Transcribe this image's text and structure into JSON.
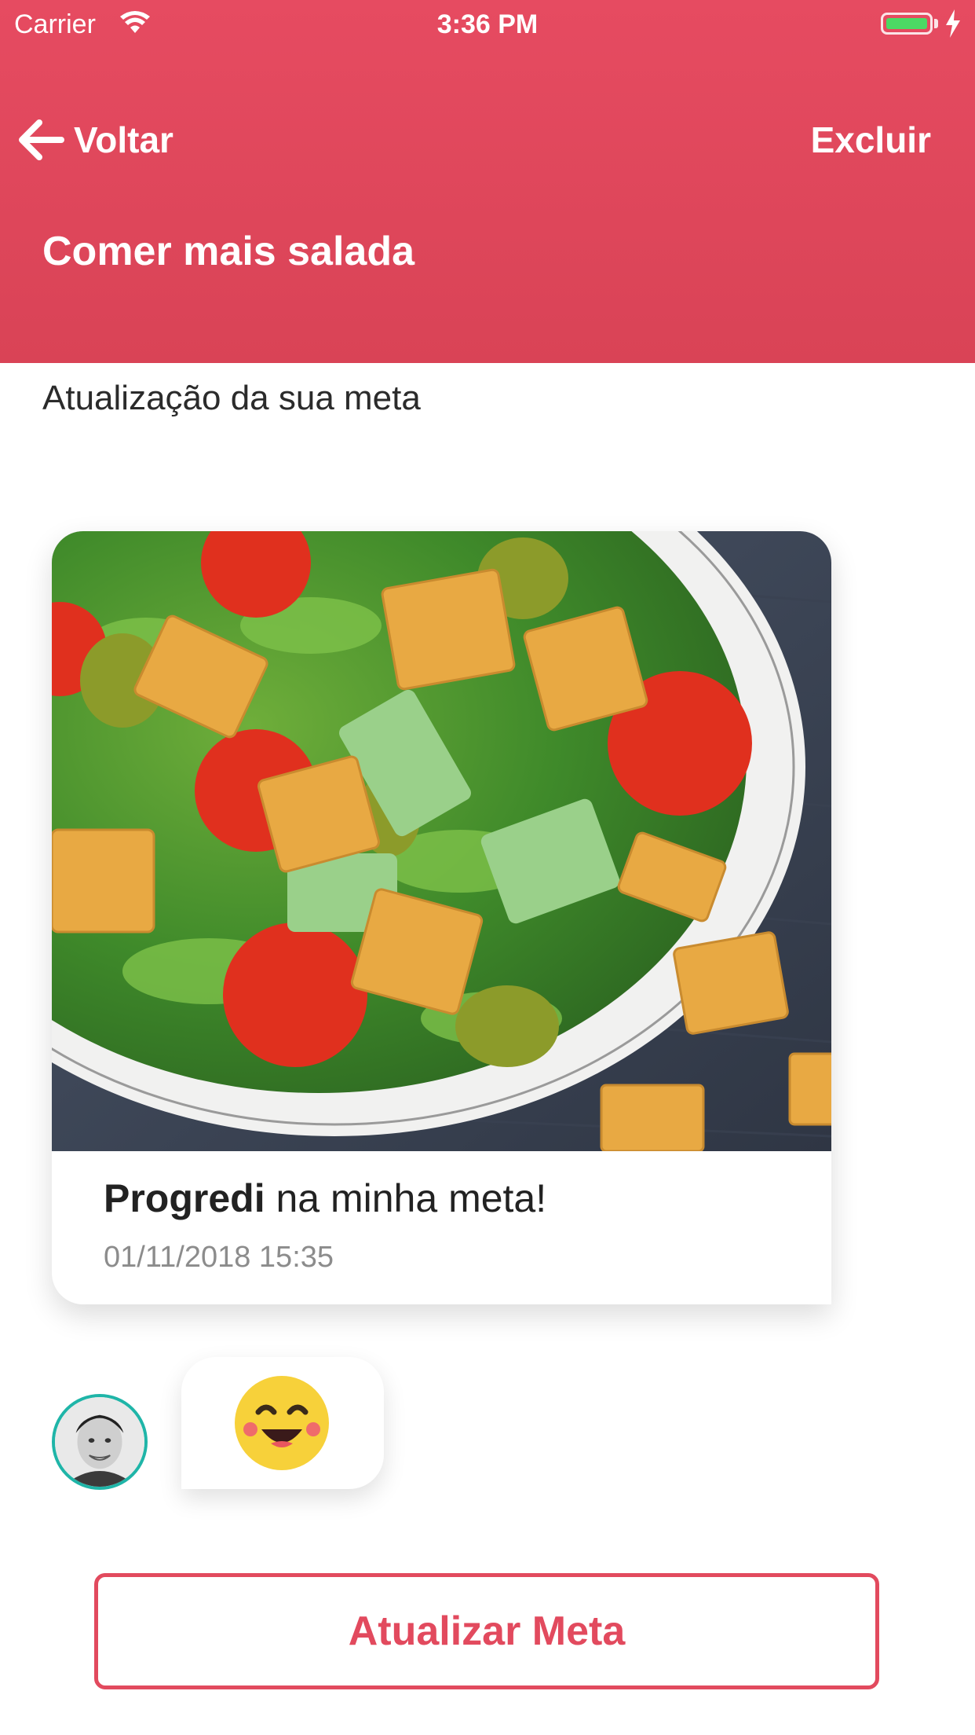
{
  "status_bar": {
    "carrier": "Carrier",
    "time": "3:36 PM",
    "wifi_icon": "wifi-icon",
    "battery_icon": "battery-icon",
    "charging_icon": "bolt-icon"
  },
  "header": {
    "back_label": "Voltar",
    "back_icon": "arrow-left-icon",
    "delete_label": "Excluir",
    "title": "Comer mais salada"
  },
  "main": {
    "subtitle": "Atualização da sua meta"
  },
  "update_card": {
    "image": "salad-photo",
    "text_bold": "Progredi",
    "text_rest": " na minha meta!",
    "date": "01/11/2018 15:35"
  },
  "reaction": {
    "avatar": "user-avatar",
    "emoji": "smiling-face-emoji"
  },
  "actions": {
    "update_label": "Atualizar Meta"
  },
  "colors": {
    "brand": "#e24a5e",
    "avatar_ring": "#1fb5a8"
  }
}
